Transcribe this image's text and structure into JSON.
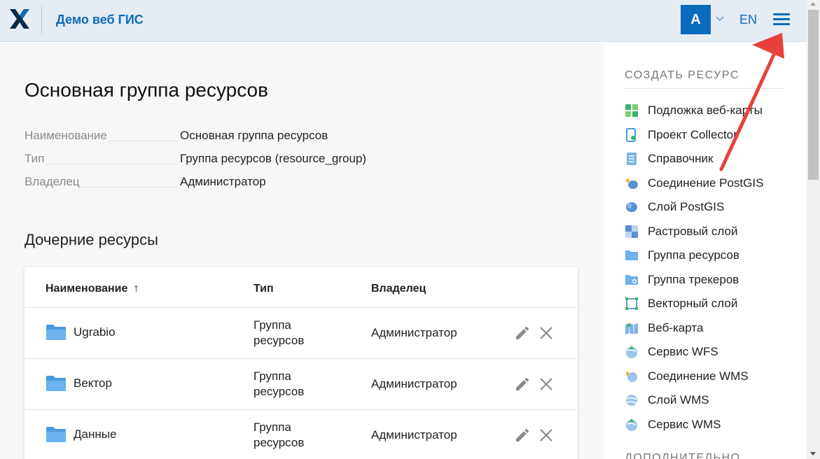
{
  "header": {
    "app_title": "Демо веб ГИС",
    "avatar_letter": "A",
    "language": "EN"
  },
  "resource": {
    "title": "Основная группа ресурсов",
    "properties": [
      {
        "key": "Наименование",
        "value": "Основная группа ресурсов"
      },
      {
        "key": "Тип",
        "value": "Группа ресурсов (resource_group)"
      },
      {
        "key": "Владелец",
        "value": "Администратор"
      }
    ]
  },
  "children": {
    "title": "Дочерние ресурсы",
    "columns": {
      "name": "Наименование",
      "sort_indicator": "↑",
      "type": "Тип",
      "owner": "Владелец"
    },
    "rows": [
      {
        "name": "Ugrabio",
        "type": "Группа ресурсов",
        "owner": "Администратор"
      },
      {
        "name": "Вектор",
        "type": "Группа ресурсов",
        "owner": "Администратор"
      },
      {
        "name": "Данные",
        "type": "Группа ресурсов",
        "owner": "Администратор"
      }
    ]
  },
  "sidebar": {
    "create_title": "СОЗДАТЬ РЕСУРС",
    "items": [
      {
        "label": "Подложка веб-карты",
        "icon": "basemap-icon"
      },
      {
        "label": "Проект Collector",
        "icon": "collector-icon"
      },
      {
        "label": "Справочник",
        "icon": "lookup-table-icon"
      },
      {
        "label": "Соединение PostGIS",
        "icon": "postgis-connection-icon"
      },
      {
        "label": "Слой PostGIS",
        "icon": "postgis-layer-icon"
      },
      {
        "label": "Растровый слой",
        "icon": "raster-layer-icon"
      },
      {
        "label": "Группа ресурсов",
        "icon": "folder-icon"
      },
      {
        "label": "Группа трекеров",
        "icon": "tracker-group-icon"
      },
      {
        "label": "Векторный слой",
        "icon": "vector-layer-icon"
      },
      {
        "label": "Веб-карта",
        "icon": "webmap-icon"
      },
      {
        "label": "Сервис WFS",
        "icon": "wfs-service-icon"
      },
      {
        "label": "Соединение WMS",
        "icon": "wms-connection-icon"
      },
      {
        "label": "Слой WMS",
        "icon": "wms-layer-icon"
      },
      {
        "label": "Сервис WMS",
        "icon": "wms-service-icon"
      }
    ],
    "extra_title": "ДОПОЛНИТЕЛЬНО"
  },
  "colors": {
    "accent": "#0b6cb8",
    "header_bg": "#e5ecf4",
    "annotation_arrow": "#e8413a"
  }
}
